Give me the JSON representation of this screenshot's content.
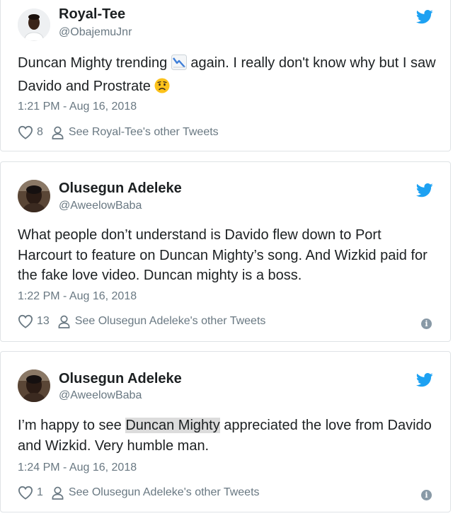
{
  "colors": {
    "twitter_blue": "#1da1f2",
    "meta_gray": "#697882",
    "text": "#1c2022",
    "border": "#dfe3e6"
  },
  "tweets": [
    {
      "name": "Royal-Tee",
      "handle": "@ObajemuJnr",
      "text_before_chart": "Duncan Mighty trending ",
      "chart_emoji_icon": "chart-decreasing-icon",
      "text_after_chart": " again.  I really don't know why but I saw Davido and Prostrate ",
      "end_emoji_icon": "worried-face-icon",
      "timestamp": "1:21 PM - Aug 16, 2018",
      "likes": "8",
      "see_other": "See Royal-Tee's other Tweets"
    },
    {
      "name": "Olusegun Adeleke",
      "handle": "@AweelowBaba",
      "text": "What people don’t understand is Davido flew down to Port Harcourt to feature on Duncan Mighty’s song. And Wizkid paid for the fake love video. Duncan mighty is a boss.",
      "timestamp": "1:22 PM - Aug 16, 2018",
      "likes": "13",
      "see_other": "See Olusegun Adeleke's other Tweets"
    },
    {
      "name": "Olusegun Adeleke",
      "handle": "@AweelowBaba",
      "text_before_highlight": "I’m happy to see ",
      "highlight": "Duncan Mighty",
      "text_after_highlight": " appreciated the love from Davido and Wizkid. Very humble man.",
      "timestamp": "1:24 PM - Aug 16, 2018",
      "likes": "1",
      "see_other": "See Olusegun Adeleke's other Tweets"
    }
  ]
}
